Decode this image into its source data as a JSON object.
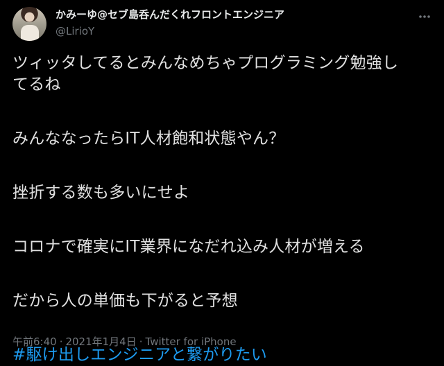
{
  "author": {
    "display_name": "かみーゆ@セブ島呑んだくれフロントエンジニア",
    "handle": "@LirioY"
  },
  "tweet": {
    "lines": [
      "ツィッタしてるとみんなめちゃプログラミング勉強し",
      "てるね",
      "みんななったらIT人材飽和状態やん？",
      "挫折する数も多いにせよ",
      "コロナで確実にIT業界になだれ込み人材が増える",
      "だから人の単価も下がると予想"
    ],
    "hashtag": "#駆け出しエンジニアと繋がりたい",
    "time": "午前6:40",
    "separator": "·",
    "date": "2021年1月4日",
    "source": "Twitter for iPhone"
  },
  "colors": {
    "background": "#000000",
    "text": "#e0e0e0",
    "muted": "#71767b",
    "link": "#1d9bf0"
  },
  "icons": {
    "more": "more-horizontal-icon"
  }
}
